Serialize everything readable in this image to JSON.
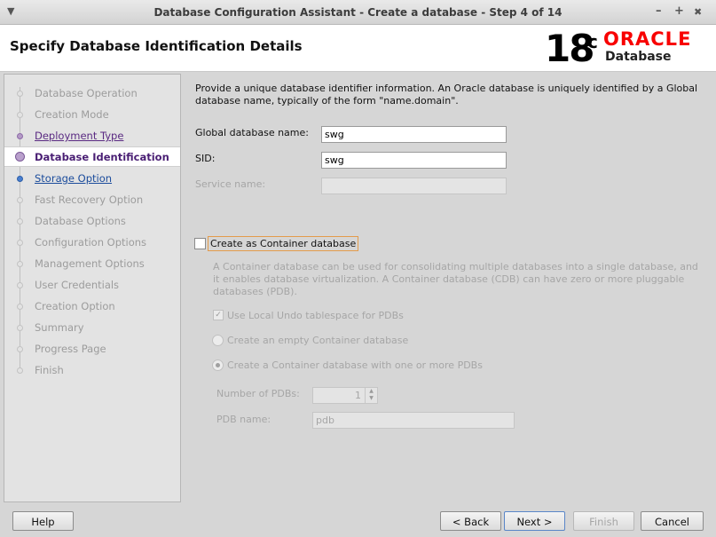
{
  "window": {
    "title": "Database Configuration Assistant - Create a database - Step 4 of 14",
    "menu_icon": "chevron-down-icon",
    "min_glyph": "–",
    "max_glyph": "+",
    "close_glyph": "✖"
  },
  "header": {
    "page_title": "Specify Database Identification Details",
    "logo": {
      "version": "18",
      "version_sup": "c",
      "brand": "ORACLE",
      "product": "Database",
      "brand_color": "#f80000"
    }
  },
  "sidebar": {
    "steps": [
      {
        "label": "Database Operation"
      },
      {
        "label": "Creation Mode"
      },
      {
        "label": "Deployment Type"
      },
      {
        "label": "Database Identification"
      },
      {
        "label": "Storage Option"
      },
      {
        "label": "Fast Recovery Option"
      },
      {
        "label": "Database Options"
      },
      {
        "label": "Configuration Options"
      },
      {
        "label": "Management Options"
      },
      {
        "label": "User Credentials"
      },
      {
        "label": "Creation Option"
      },
      {
        "label": "Summary"
      },
      {
        "label": "Progress Page"
      },
      {
        "label": "Finish"
      }
    ]
  },
  "form": {
    "description": "Provide a unique database identifier information. An Oracle database is uniquely identified by a Global database name, typically of the form \"name.domain\".",
    "global_db_name_label": "Global database name:",
    "global_db_name_value": "swg",
    "sid_label": "SID:",
    "sid_value": "swg",
    "service_name_label": "Service name:",
    "service_name_value": "",
    "container_checkbox_label": "Create as Container database",
    "container_checked": false,
    "container_description": "A Container database can be used for consolidating multiple databases into a single database, and it enables database virtualization. A Container database (CDB) can have zero or more pluggable databases (PDB).",
    "local_undo_label": "Use Local Undo tablespace for PDBs",
    "local_undo_checked": true,
    "empty_cdb_label": "Create an empty Container database",
    "with_pdbs_label": "Create a Container database with one or more PDBs",
    "num_pdbs_label": "Number of PDBs:",
    "num_pdbs_value": "1",
    "pdb_name_label": "PDB name:",
    "pdb_name_value": "pdb"
  },
  "buttons": {
    "help": "Help",
    "back": "< Back",
    "next": "Next >",
    "finish": "Finish",
    "cancel": "Cancel"
  }
}
